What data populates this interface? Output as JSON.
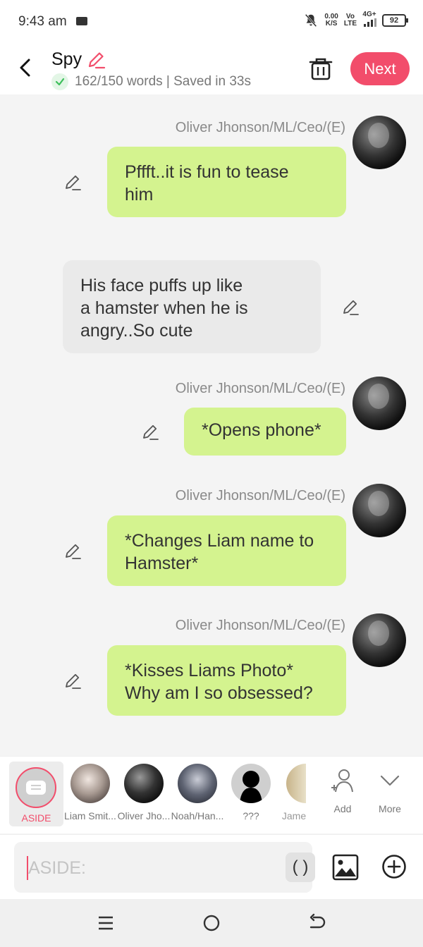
{
  "status_bar": {
    "time": "9:43 am",
    "net_speed_value": "0.00",
    "net_speed_unit": "K/S",
    "volte_top": "Vo",
    "volte_bottom": "LTE",
    "network": "4G+",
    "battery": "92"
  },
  "header": {
    "title": "Spy",
    "subtitle": "162/150 words | Saved in 33s",
    "next_label": "Next",
    "accent_color": "#f24d6b"
  },
  "chat": {
    "messages": [
      {
        "sender": "Oliver Jhonson/ML/Ceo/(E)",
        "line1": "Pffft..it is fun to tease",
        "line2": "him",
        "style": "green"
      },
      {
        "sender": "",
        "line1": "His face puffs up like",
        "line2": "a hamster when he is",
        "line3": "angry..So cute",
        "style": "gray"
      },
      {
        "sender": "Oliver Jhonson/ML/Ceo/(E)",
        "line1": "*Opens phone*",
        "style": "green"
      },
      {
        "sender": "Oliver Jhonson/ML/Ceo/(E)",
        "line1": "*Changes Liam name to",
        "line2": "Hamster*",
        "style": "green"
      },
      {
        "sender": "Oliver Jhonson/ML/Ceo/(E)",
        "line1": "*Kisses Liams Photo*",
        "line2": "Why am I so obsessed?",
        "style": "green"
      }
    ]
  },
  "characters": {
    "aside_label": "ASIDE",
    "items": [
      {
        "label": "Liam Smit..."
      },
      {
        "label": "Oliver Jho..."
      },
      {
        "label": "Noah/Han..."
      },
      {
        "label": "???"
      },
      {
        "label": "Jame"
      }
    ],
    "add_label": "Add",
    "more_label": "More"
  },
  "input": {
    "placeholder": "ASIDE:",
    "paren_label": "( )"
  }
}
